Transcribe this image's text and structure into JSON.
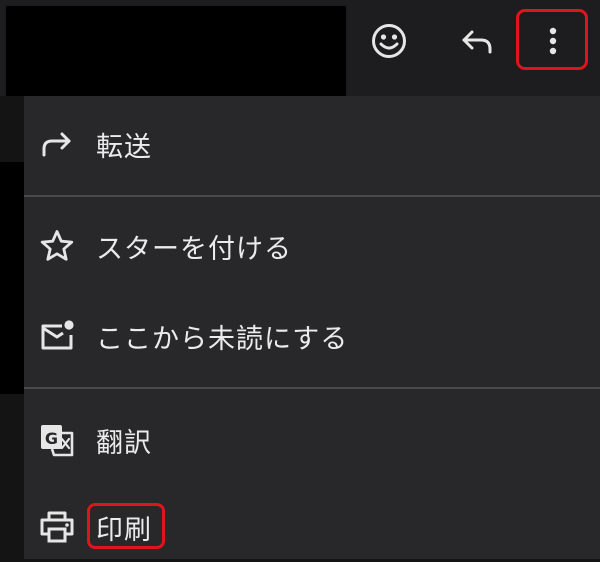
{
  "toolbar": {
    "icons": [
      "smiley-icon",
      "reply-icon",
      "more-vertical-icon"
    ]
  },
  "menu": {
    "items": [
      {
        "label": "転送",
        "icon": "forward-icon"
      },
      {
        "label": "スターを付ける",
        "icon": "star-icon"
      },
      {
        "label": "ここから未読にする",
        "icon": "mark-unread-icon"
      },
      {
        "label": "翻訳",
        "icon": "translate-icon"
      },
      {
        "label": "印刷",
        "icon": "print-icon"
      }
    ]
  },
  "colors": {
    "toolbar_bg": "#1d1d1f",
    "menu_bg": "#28282a",
    "divider": "#4a4a4c",
    "text": "#ebebeb",
    "highlight": "#e0141e"
  }
}
